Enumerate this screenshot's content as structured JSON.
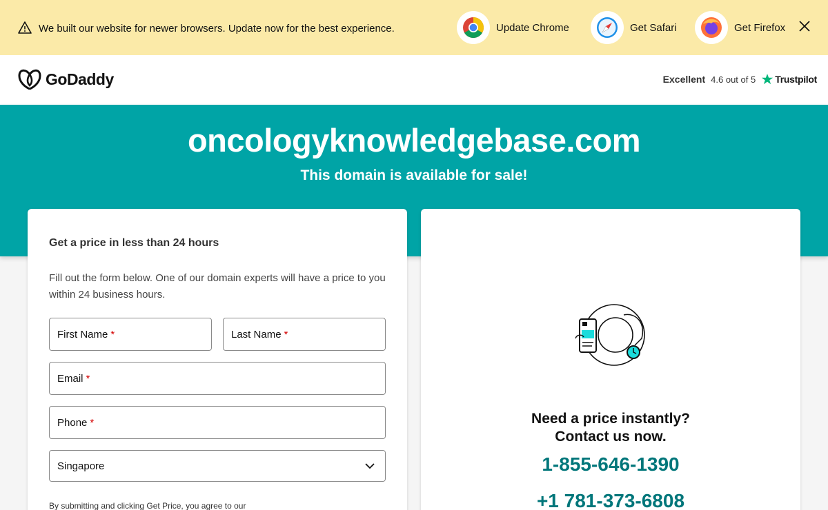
{
  "banner": {
    "message": "We built our website for newer browsers. Update now for the best experience.",
    "browsers": [
      {
        "label": "Update Chrome",
        "icon": "chrome-icon"
      },
      {
        "label": "Get Safari",
        "icon": "safari-icon"
      },
      {
        "label": "Get Firefox",
        "icon": "firefox-icon"
      }
    ],
    "close_icon": "close-icon"
  },
  "header": {
    "logo_text": "GoDaddy",
    "rating_word": "Excellent",
    "rating_score": "4.6 out of 5",
    "trustpilot": "Trustpilot"
  },
  "hero": {
    "domain": "oncologyknowledgebase.com",
    "subtitle": "This domain is available for sale!"
  },
  "form": {
    "title": "Get a price in less than 24 hours",
    "description": "Fill out the form below. One of our domain experts will have a price to you within 24 business hours.",
    "first_name": "First Name",
    "last_name": "Last Name",
    "email": "Email",
    "phone": "Phone",
    "required_mark": "*",
    "country": "Singapore",
    "legal": "By submitting and clicking Get Price, you agree to our"
  },
  "contact": {
    "line1": "Need a price instantly?",
    "line2": "Contact us now.",
    "phone1": "1-855-646-1390",
    "phone2": "+1 781-373-6808"
  },
  "colors": {
    "banner_bg": "#fbeaa8",
    "hero_bg": "#00a4a6",
    "phone_text": "#00767a",
    "trustpilot_star": "#00b67a"
  }
}
